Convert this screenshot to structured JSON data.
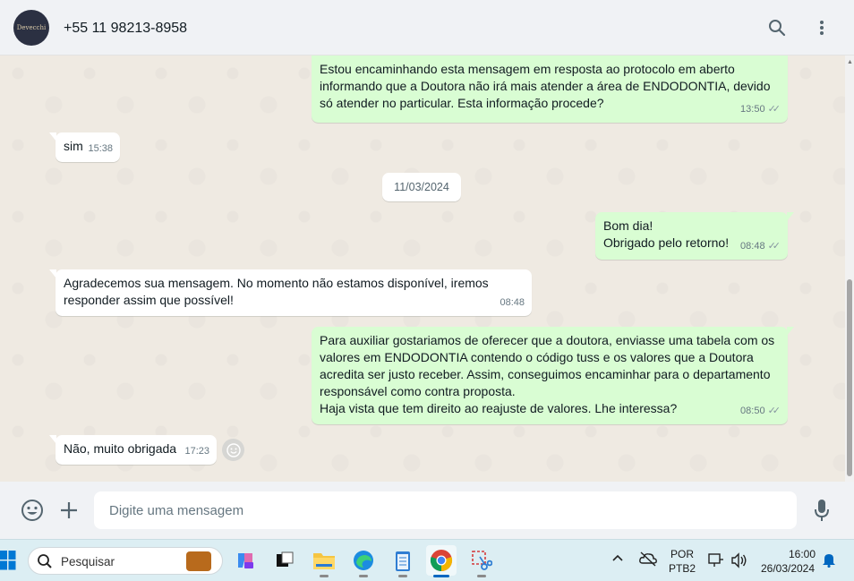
{
  "header": {
    "avatar_text": "Devecchi",
    "contact_name": "+55 11 98213-8958",
    "icons": [
      "search-icon",
      "menu-icon"
    ]
  },
  "chat": {
    "messages": [
      {
        "direction": "outgoing",
        "text": "Estou encaminhando esta mensagem em resposta ao protocolo em aberto\ninformando que a Doutora não irá mais atender a área de ENDODONTIA, devido\nsó atender no particular. Esta informação procede?",
        "time": "13:50",
        "status": "read"
      },
      {
        "direction": "incoming",
        "text": "sim",
        "time": "15:38"
      },
      {
        "direction": "outgoing",
        "text": "Bom dia!\nObrigado pelo retorno!",
        "time": "08:48",
        "status": "read"
      },
      {
        "direction": "incoming",
        "text": "Agradecemos sua mensagem. No momento não estamos disponível, iremos\nresponder assim que possível!",
        "time": "08:48"
      },
      {
        "direction": "outgoing",
        "text": "Para auxiliar gostariamos de oferecer que a doutora, enviasse uma tabela com os\nvalores em ENDODONTIA contendo o código tuss e os valores que a Doutora\nacredita ser justo receber. Assim, conseguimos encaminhar para o departamento\nresponsável como contra proposta.\nHaja vista que tem direito ao reajuste de valores. Lhe interessa?",
        "time": "08:50",
        "status": "read"
      },
      {
        "direction": "incoming",
        "text": "Não, muito obrigada",
        "time": "17:23"
      }
    ],
    "date_divider": "11/03/2024"
  },
  "composer": {
    "placeholder": "Digite uma mensagem",
    "value": "",
    "icons": [
      "emoji-icon",
      "plus-icon",
      "microphone-icon"
    ]
  },
  "taskbar": {
    "search_placeholder": "Pesquisar",
    "language_line1": "POR",
    "language_line2": "PTB2",
    "time": "16:00",
    "date": "26/03/2024",
    "apps": [
      "copilot-icon",
      "task-view-icon",
      "file-explorer-icon",
      "edge-icon",
      "notepad-icon",
      "chrome-icon",
      "snipping-tool-icon"
    ]
  },
  "colors": {
    "outgoing_bubble": "#d9fdd3",
    "incoming_bubble": "#ffffff",
    "chat_background": "#efeae2",
    "header_background": "#f0f2f5"
  }
}
